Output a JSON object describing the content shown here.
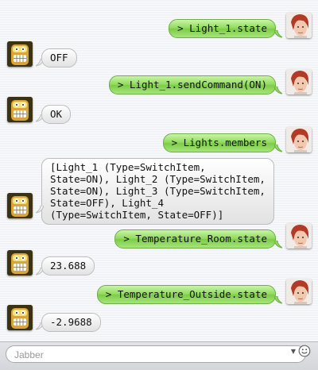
{
  "messages": [
    {
      "from": "user",
      "text": "> Light_1.state"
    },
    {
      "from": "bot",
      "text": "OFF"
    },
    {
      "from": "user",
      "text": "> Light_1.sendCommand(ON)"
    },
    {
      "from": "bot",
      "text": "OK"
    },
    {
      "from": "user",
      "text": "> Lights.members"
    },
    {
      "from": "bot",
      "text": "[Light_1 (Type=SwitchItem,\nState=ON), Light_2 (Type=SwitchItem,\nState=ON), Light_3 (Type=SwitchItem,\nState=OFF), Light_4\n(Type=SwitchItem, State=OFF)]"
    },
    {
      "from": "user",
      "text": "> Temperature_Room.state"
    },
    {
      "from": "bot",
      "text": "23.688"
    },
    {
      "from": "user",
      "text": "> Temperature_Outside.state"
    },
    {
      "from": "bot",
      "text": "-2.9688"
    }
  ],
  "input": {
    "placeholder": "Jabber"
  },
  "icons": {
    "user_avatar": "user-portrait-icon",
    "bot_avatar": "robot-avatar-icon",
    "emoji": "smiley-icon",
    "dropdown": "chevron-down-icon"
  },
  "colors": {
    "outgoing_bubble": "#8fda5b",
    "incoming_bubble": "#f0f0f0",
    "background": "#f1f3f6"
  }
}
